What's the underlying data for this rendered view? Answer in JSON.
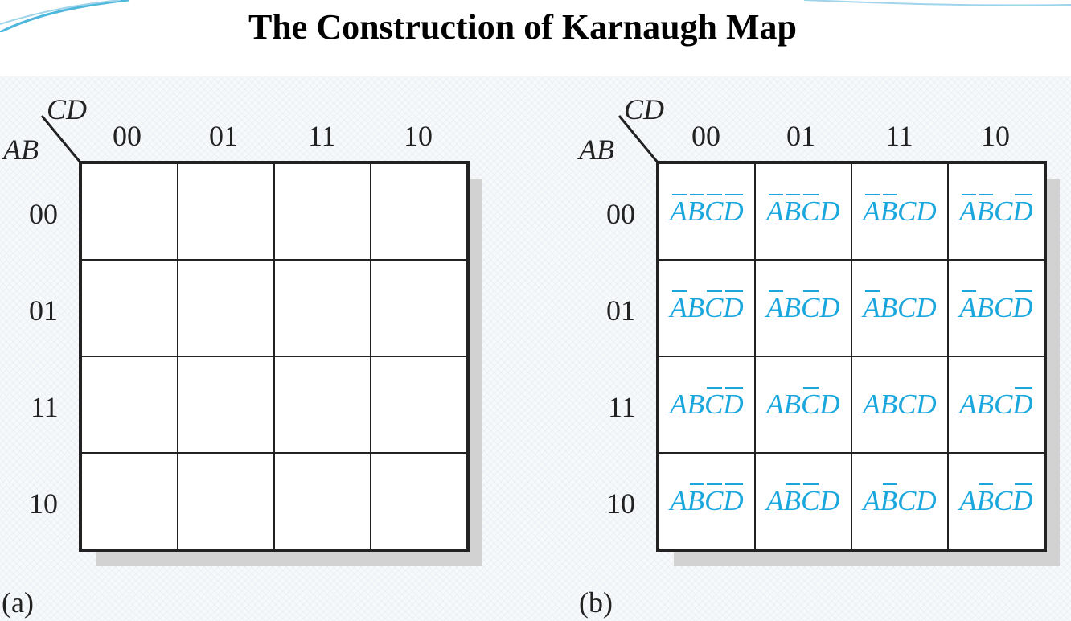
{
  "title": "The Construction of Karnaugh Map",
  "column_variables": "CD",
  "row_variables": "AB",
  "column_codes": [
    "00",
    "01",
    "11",
    "10"
  ],
  "row_codes": [
    "00",
    "01",
    "11",
    "10"
  ],
  "panels": [
    {
      "caption": "(a)"
    },
    {
      "caption": "(b)"
    }
  ],
  "minterms": [
    [
      [
        {
          "v": "A",
          "neg": true
        },
        {
          "v": "B",
          "neg": true
        },
        {
          "v": "C",
          "neg": true
        },
        {
          "v": "D",
          "neg": true
        }
      ],
      [
        {
          "v": "A",
          "neg": true
        },
        {
          "v": "B",
          "neg": true
        },
        {
          "v": "C",
          "neg": true
        },
        {
          "v": "D",
          "neg": false
        }
      ],
      [
        {
          "v": "A",
          "neg": true
        },
        {
          "v": "B",
          "neg": true
        },
        {
          "v": "C",
          "neg": false
        },
        {
          "v": "D",
          "neg": false
        }
      ],
      [
        {
          "v": "A",
          "neg": true
        },
        {
          "v": "B",
          "neg": true
        },
        {
          "v": "C",
          "neg": false
        },
        {
          "v": "D",
          "neg": true
        }
      ]
    ],
    [
      [
        {
          "v": "A",
          "neg": true
        },
        {
          "v": "B",
          "neg": false
        },
        {
          "v": "C",
          "neg": true
        },
        {
          "v": "D",
          "neg": true
        }
      ],
      [
        {
          "v": "A",
          "neg": true
        },
        {
          "v": "B",
          "neg": false
        },
        {
          "v": "C",
          "neg": true
        },
        {
          "v": "D",
          "neg": false
        }
      ],
      [
        {
          "v": "A",
          "neg": true
        },
        {
          "v": "B",
          "neg": false
        },
        {
          "v": "C",
          "neg": false
        },
        {
          "v": "D",
          "neg": false
        }
      ],
      [
        {
          "v": "A",
          "neg": true
        },
        {
          "v": "B",
          "neg": false
        },
        {
          "v": "C",
          "neg": false
        },
        {
          "v": "D",
          "neg": true
        }
      ]
    ],
    [
      [
        {
          "v": "A",
          "neg": false
        },
        {
          "v": "B",
          "neg": false
        },
        {
          "v": "C",
          "neg": true
        },
        {
          "v": "D",
          "neg": true
        }
      ],
      [
        {
          "v": "A",
          "neg": false
        },
        {
          "v": "B",
          "neg": false
        },
        {
          "v": "C",
          "neg": true
        },
        {
          "v": "D",
          "neg": false
        }
      ],
      [
        {
          "v": "A",
          "neg": false
        },
        {
          "v": "B",
          "neg": false
        },
        {
          "v": "C",
          "neg": false
        },
        {
          "v": "D",
          "neg": false
        }
      ],
      [
        {
          "v": "A",
          "neg": false
        },
        {
          "v": "B",
          "neg": false
        },
        {
          "v": "C",
          "neg": false
        },
        {
          "v": "D",
          "neg": true
        }
      ]
    ],
    [
      [
        {
          "v": "A",
          "neg": false
        },
        {
          "v": "B",
          "neg": true
        },
        {
          "v": "C",
          "neg": true
        },
        {
          "v": "D",
          "neg": true
        }
      ],
      [
        {
          "v": "A",
          "neg": false
        },
        {
          "v": "B",
          "neg": true
        },
        {
          "v": "C",
          "neg": true
        },
        {
          "v": "D",
          "neg": false
        }
      ],
      [
        {
          "v": "A",
          "neg": false
        },
        {
          "v": "B",
          "neg": true
        },
        {
          "v": "C",
          "neg": false
        },
        {
          "v": "D",
          "neg": false
        }
      ],
      [
        {
          "v": "A",
          "neg": false
        },
        {
          "v": "B",
          "neg": true
        },
        {
          "v": "C",
          "neg": false
        },
        {
          "v": "D",
          "neg": true
        }
      ]
    ]
  ],
  "colors": {
    "minterm_text": "#1aa7de",
    "grid_line": "#222222",
    "shadow": "#d2d2d2",
    "accent_swoosh": "#4fb7dc"
  }
}
